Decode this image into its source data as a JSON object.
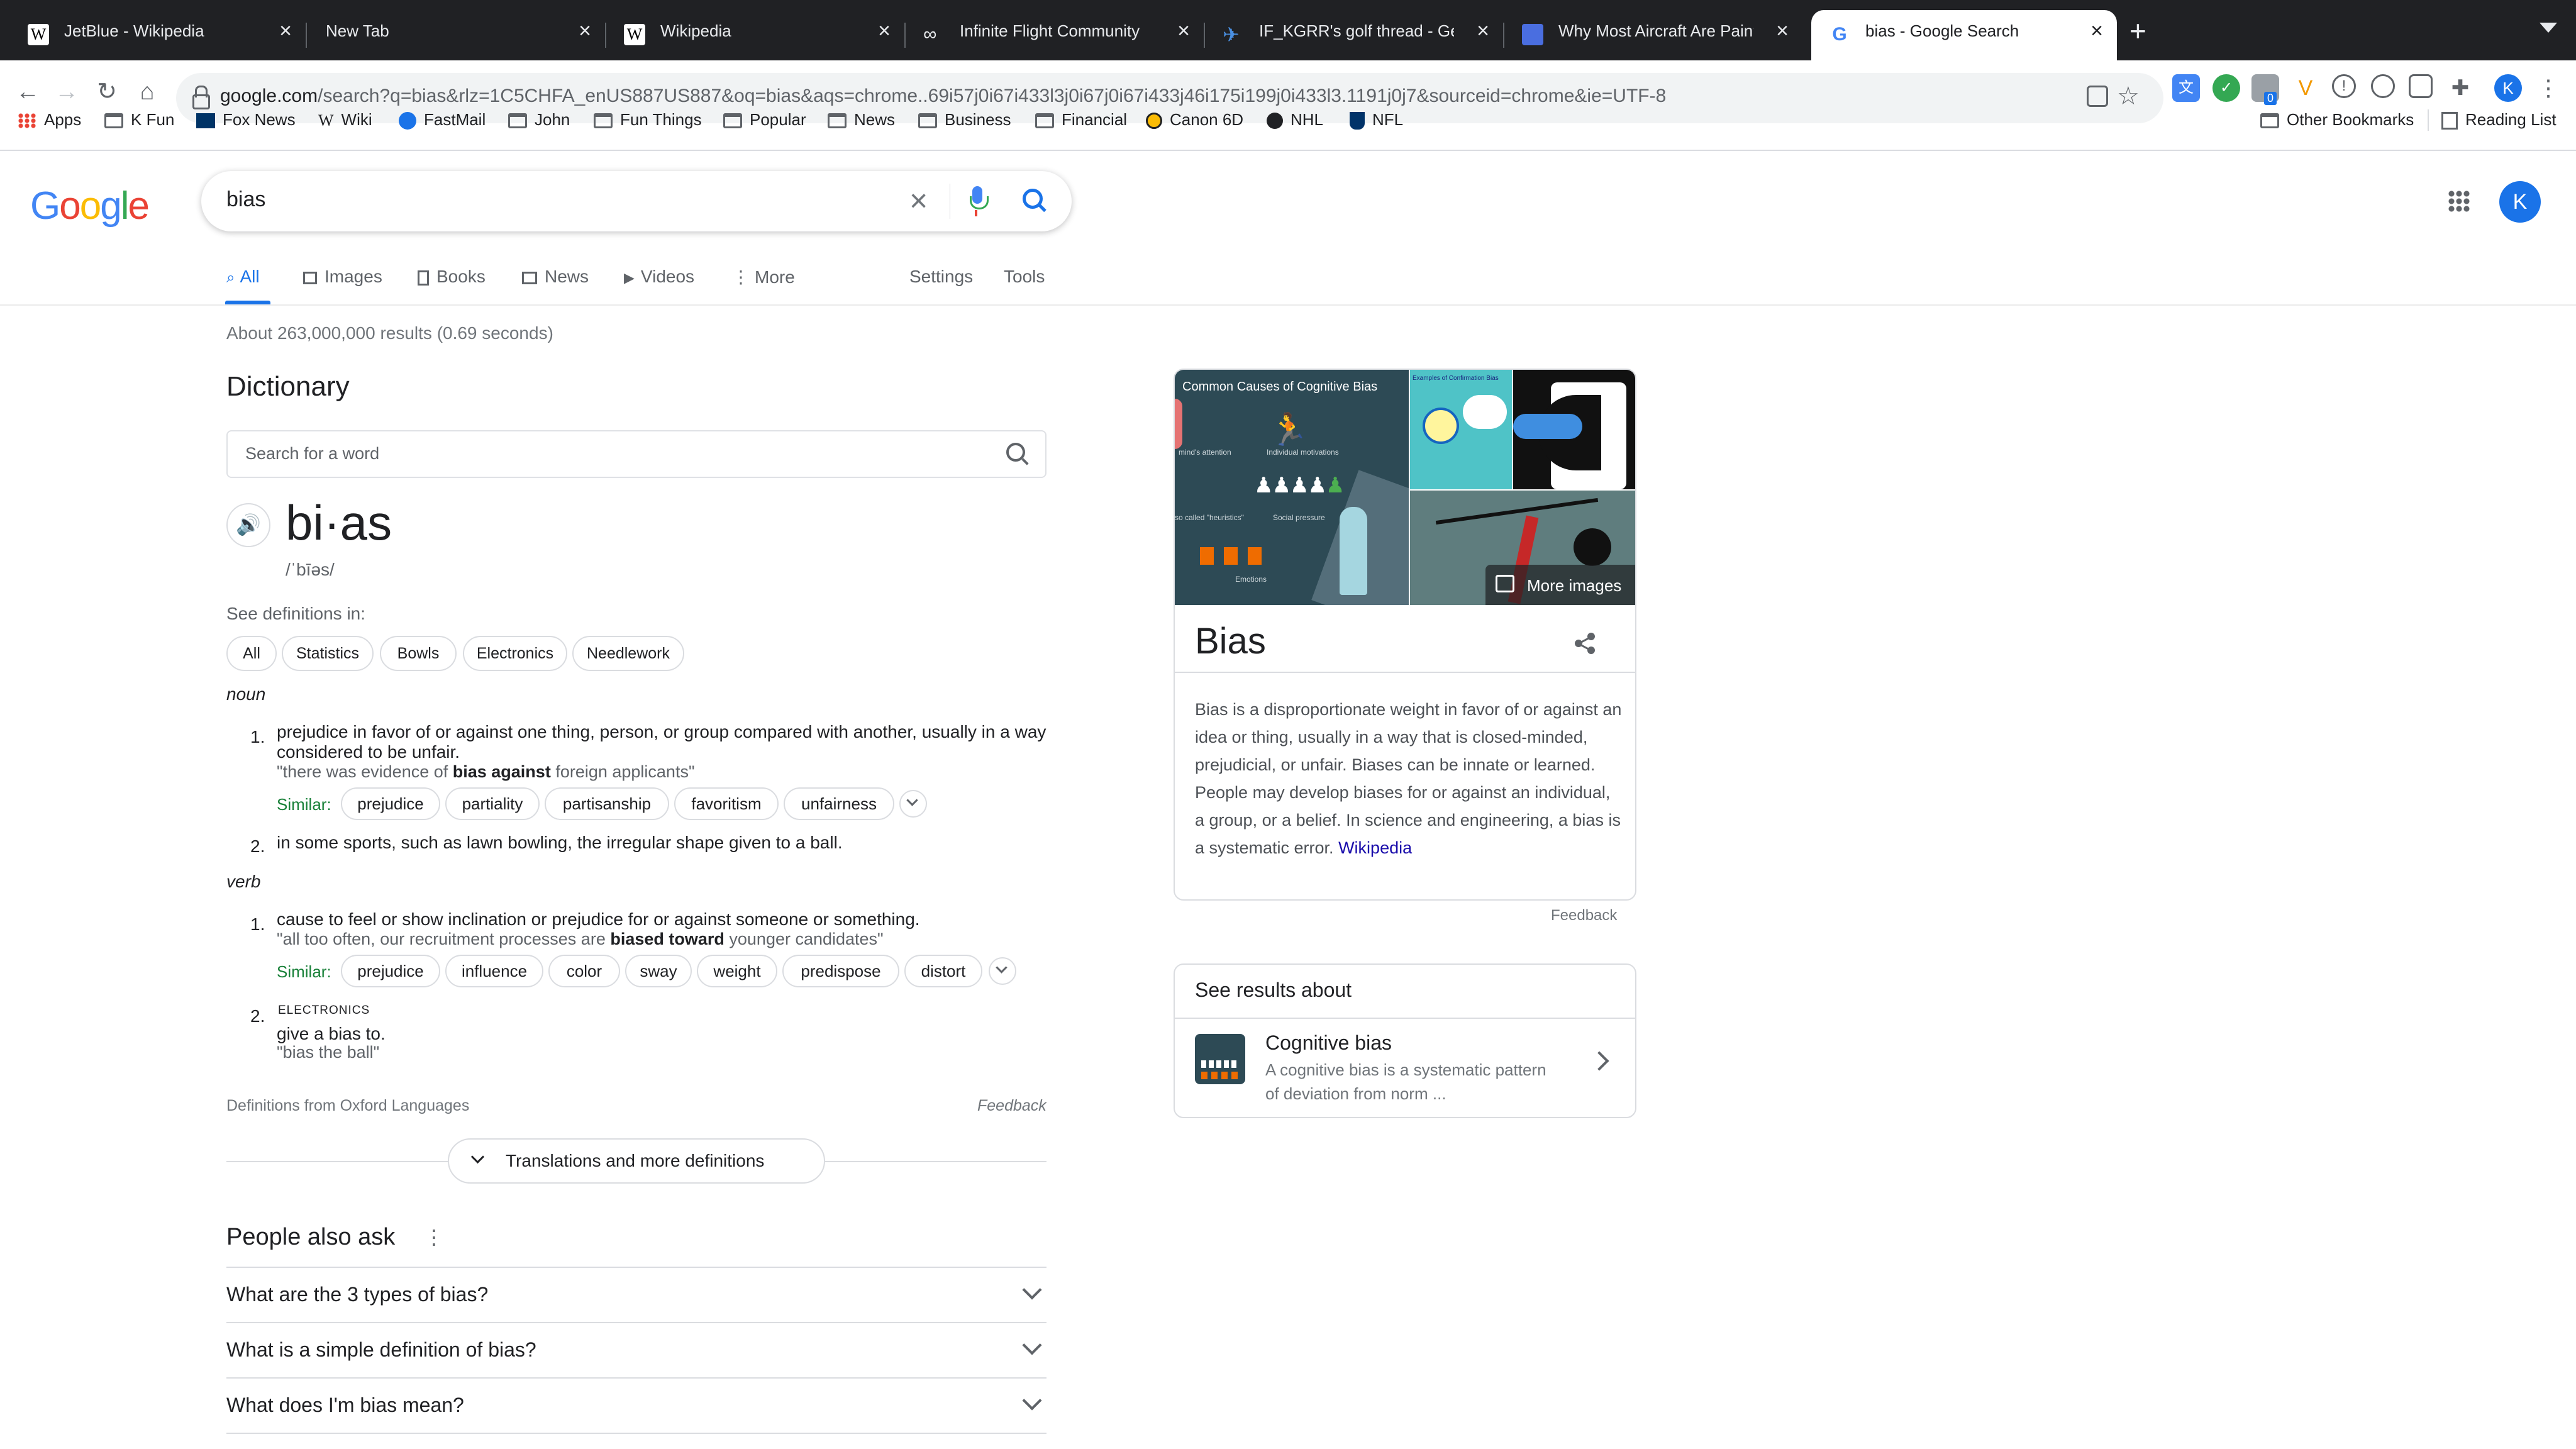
{
  "browser": {
    "tabs": [
      {
        "title": "JetBlue - Wikipedia",
        "icon": "wikipedia-icon"
      },
      {
        "title": "New Tab",
        "icon": ""
      },
      {
        "title": "Wikipedia",
        "icon": "wikipedia-icon"
      },
      {
        "title": "Infinite Flight Community",
        "icon": "infinite-flight-icon"
      },
      {
        "title": "IF_KGRR's golf thread - Gener",
        "icon": "flight-icon"
      },
      {
        "title": "Why Most Aircraft Are Painted",
        "icon": "article-icon"
      },
      {
        "title": "bias - Google Search",
        "icon": "google-icon"
      }
    ],
    "new_tab_symbol": "+",
    "url_host": "google.com",
    "url_path": "/search?q=bias&rlz=1C5CHFA_enUS887US887&oq=bias&aqs=chrome..69i57j0i67i433l3j0i67j0i67i433j46i175i199j0i433l3.1191j0j7&sourceid=chrome&ie=UTF-8",
    "profile_initial": "K",
    "extension_badge": "0",
    "bookmarks": [
      {
        "label": "Apps",
        "icon": "apps-grid-icon"
      },
      {
        "label": "K Fun",
        "icon": "folder-icon"
      },
      {
        "label": "Fox News",
        "icon": "fox-news-icon"
      },
      {
        "label": "Wiki",
        "icon": "wikipedia-icon"
      },
      {
        "label": "FastMail",
        "icon": "fastmail-icon"
      },
      {
        "label": "John",
        "icon": "folder-icon"
      },
      {
        "label": "Fun Things",
        "icon": "folder-icon"
      },
      {
        "label": "Popular",
        "icon": "folder-icon"
      },
      {
        "label": "News",
        "icon": "folder-icon"
      },
      {
        "label": "Business",
        "icon": "folder-icon"
      },
      {
        "label": "Financial",
        "icon": "folder-icon"
      },
      {
        "label": "Canon 6D",
        "icon": "canon-icon"
      },
      {
        "label": "NHL",
        "icon": "nhl-icon"
      },
      {
        "label": "NFL",
        "icon": "nfl-icon"
      }
    ],
    "other_bookmarks": "Other Bookmarks",
    "reading_list": "Reading List"
  },
  "google": {
    "logo_letters": [
      "G",
      "o",
      "o",
      "g",
      "l",
      "e"
    ],
    "logo_colors": [
      "#4285F4",
      "#EA4335",
      "#FBBC05",
      "#4285F4",
      "#34A853",
      "#EA4335"
    ],
    "query": "bias",
    "account_initial": "K",
    "tabs": [
      "All",
      "Images",
      "Books",
      "News",
      "Videos",
      "More"
    ],
    "settings": "Settings",
    "tools": "Tools",
    "result_stats": "About 263,000,000 results (0.69 seconds)"
  },
  "dictionary": {
    "heading": "Dictionary",
    "search_placeholder": "Search for a word",
    "word": "bi·as",
    "phonetic": "/ˈbīəs/",
    "see_definitions": "See definitions in:",
    "domains": [
      "All",
      "Statistics",
      "Bowls",
      "Electronics",
      "Needlework"
    ],
    "noun_label": "noun",
    "verb_label": "verb",
    "noun_defs": [
      {
        "num": "1.",
        "text": "prejudice in favor of or against one thing, person, or group compared with another, usually in a way considered to be unfair.",
        "example_pre": "\"there was evidence of ",
        "example_bold": "bias against",
        "example_post": " foreign applicants\"",
        "similar": [
          "prejudice",
          "partiality",
          "partisanship",
          "favoritism",
          "unfairness"
        ]
      },
      {
        "num": "2.",
        "text": "in some sports, such as lawn bowling, the irregular shape given to a ball."
      }
    ],
    "verb_defs": [
      {
        "num": "1.",
        "text": "cause to feel or show inclination or prejudice for or against someone or something.",
        "example_pre": "\"all too often, our recruitment processes are ",
        "example_bold": "biased toward",
        "example_post": " younger candidates\"",
        "similar": [
          "prejudice",
          "influence",
          "color",
          "sway",
          "weight",
          "predispose",
          "distort"
        ]
      },
      {
        "num": "2.",
        "tag": "ELECTRONICS",
        "text": "give a bias to.",
        "example": "\"bias the ball\""
      }
    ],
    "similar_label": "Similar:",
    "source": "Definitions from Oxford Languages",
    "feedback": "Feedback",
    "more_button": "Translations and more definitions"
  },
  "people_also_ask": {
    "heading": "People also ask",
    "questions": [
      "What are the 3 types of bias?",
      "What is a simple definition of bias?",
      "What does I'm bias mean?"
    ]
  },
  "knowledge_panel": {
    "image_caption": "Common Causes of Cognitive Bias",
    "image_caption_2": "Examples of Confirmation Bias",
    "image_labels": [
      "mind's attention",
      "Individual motivations",
      "so called \"heuristics\"",
      "Social pressure",
      "Emotions"
    ],
    "more_images": "More images",
    "title": "Bias",
    "description": "Bias is a disproportionate weight in favor of or against an idea or thing, usually in a way that is closed-minded, prejudicial, or unfair. Biases can be innate or learned. People may develop biases for or against an individual, a group, or a belief. In science and engineering, a bias is a systematic error. ",
    "source_link": "Wikipedia",
    "feedback": "Feedback"
  },
  "see_results_about": {
    "heading": "See results about",
    "item_title": "Cognitive bias",
    "item_desc_1": "A cognitive bias is a systematic pattern",
    "item_desc_2": "of deviation from norm ..."
  }
}
